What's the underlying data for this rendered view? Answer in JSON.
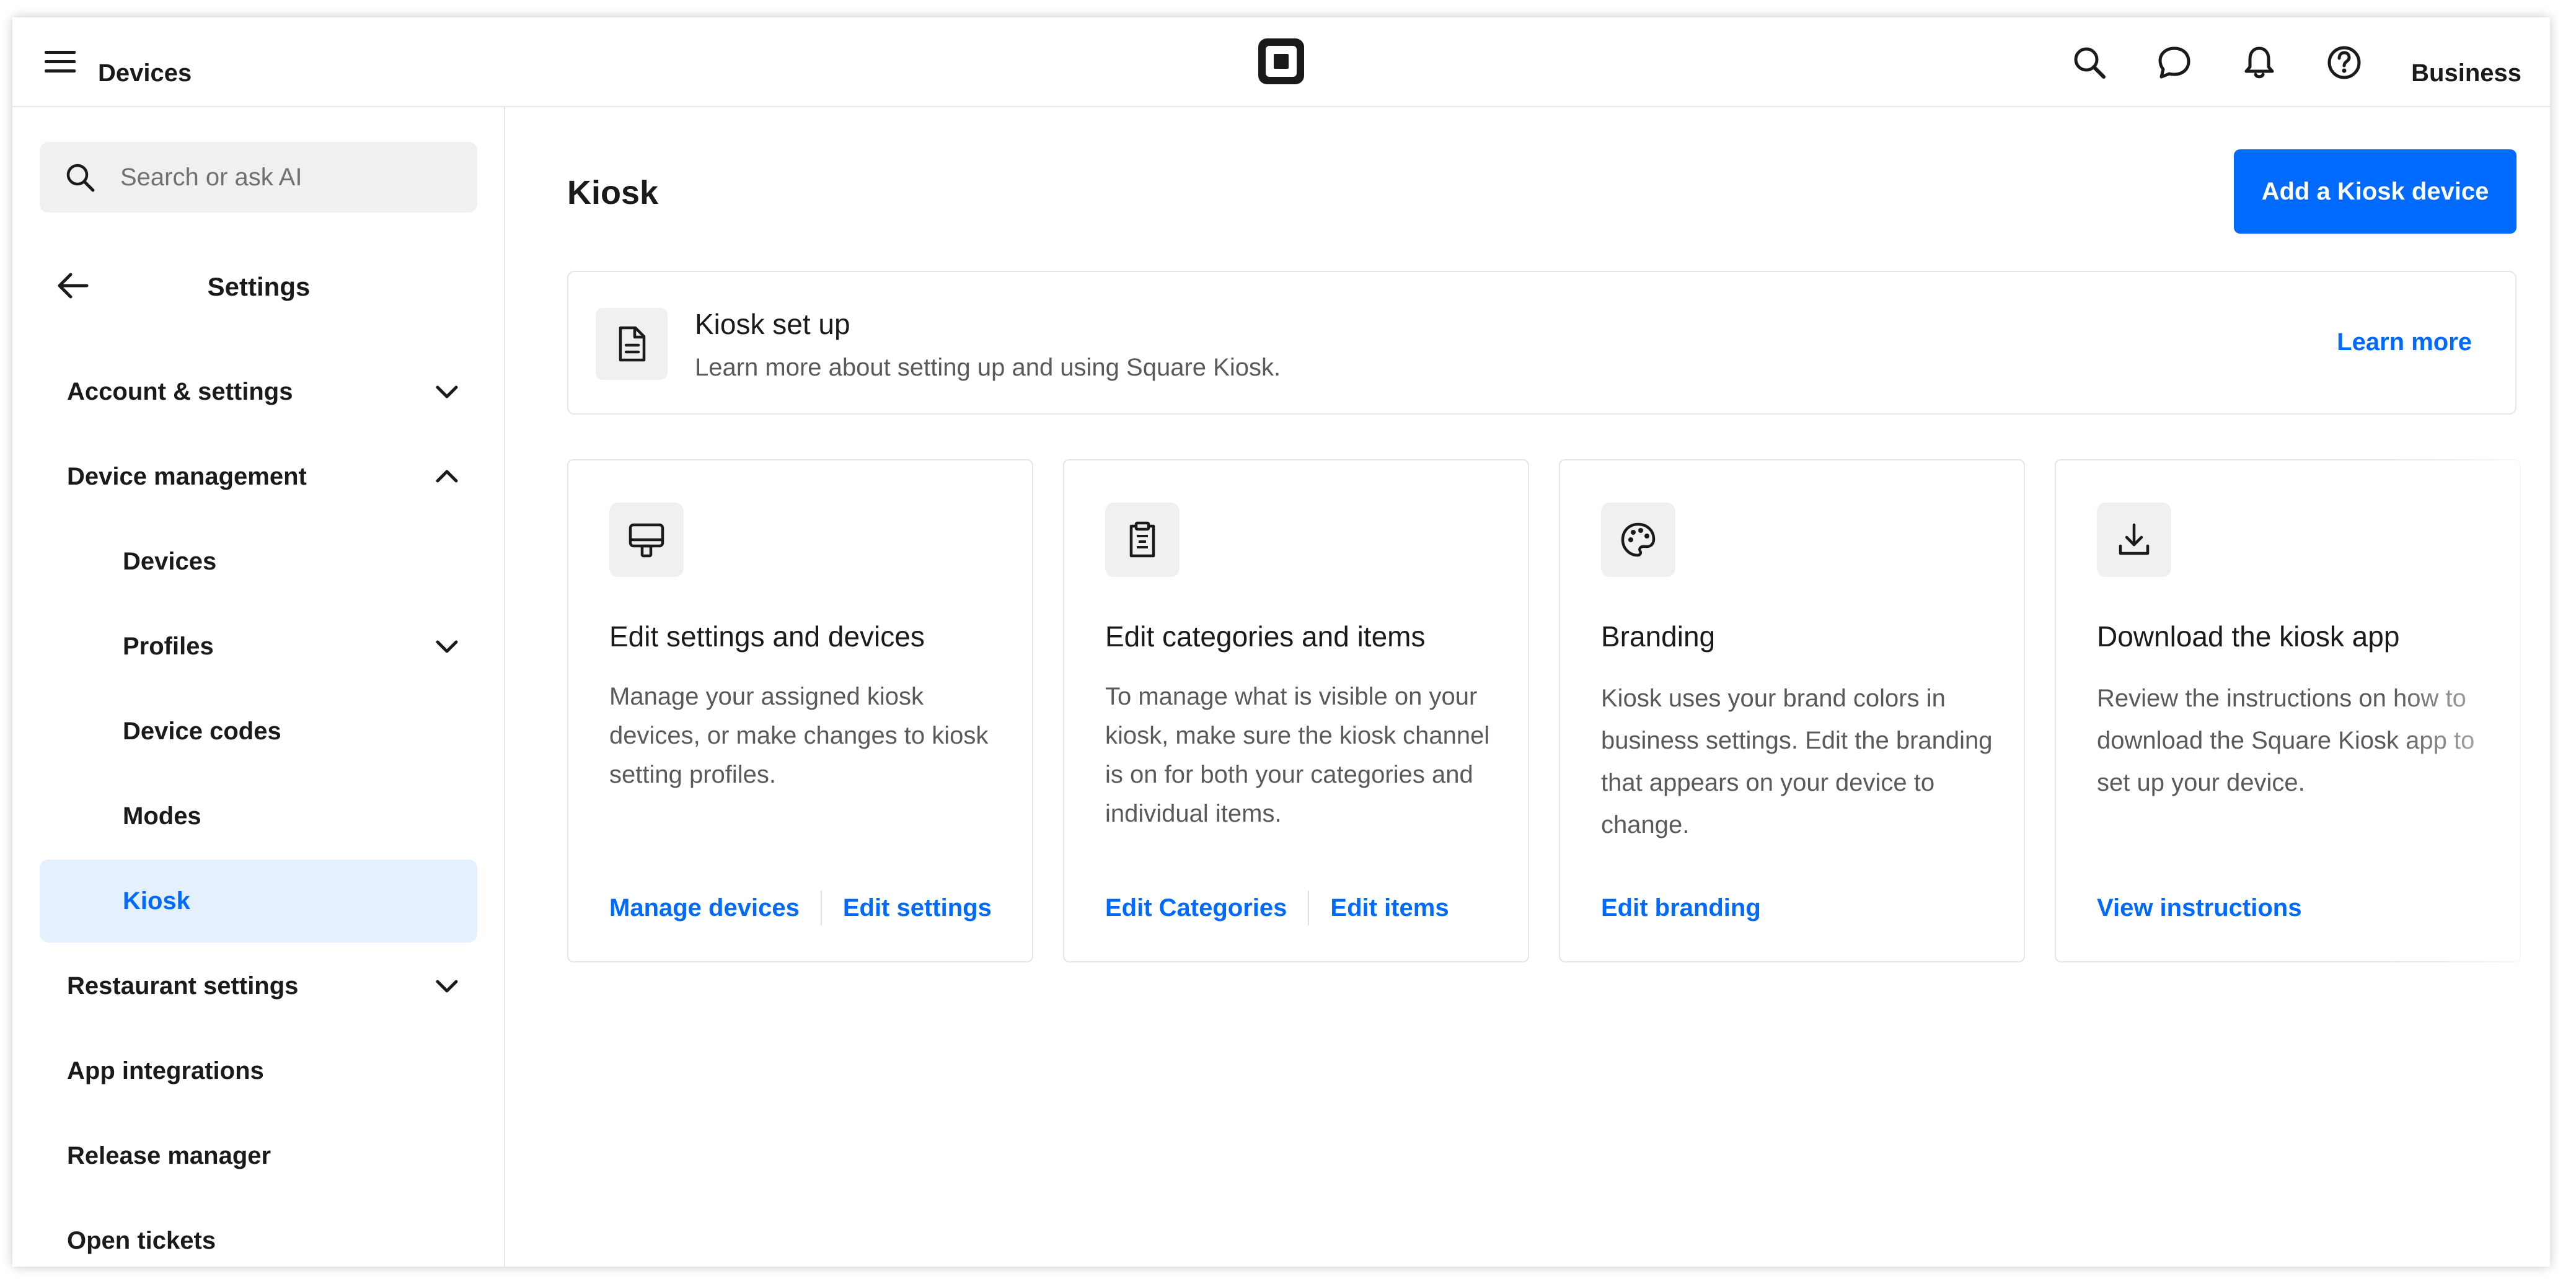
{
  "topbar": {
    "title": "Devices",
    "account": "Business",
    "icons": [
      "menu-icon",
      "square-logo-icon",
      "search-icon",
      "chat-icon",
      "bell-icon",
      "help-icon"
    ]
  },
  "sidebar": {
    "search_placeholder": "Search or ask AI",
    "heading": "Settings",
    "items": [
      {
        "label": "Account & settings",
        "chevron": "down"
      },
      {
        "label": "Device management",
        "chevron": "up"
      },
      {
        "label": "Devices"
      },
      {
        "label": "Profiles",
        "chevron": "down"
      },
      {
        "label": "Device codes"
      },
      {
        "label": "Modes"
      },
      {
        "label": "Kiosk",
        "active": true
      },
      {
        "label": "Restaurant settings",
        "chevron": "down"
      },
      {
        "label": "App integrations"
      },
      {
        "label": "Release manager"
      },
      {
        "label": "Open tickets"
      }
    ]
  },
  "main": {
    "title": "Kiosk",
    "primary_button": "Add a Kiosk device",
    "banner": {
      "title": "Kiosk set up",
      "description": "Learn more about setting up and using Square Kiosk.",
      "link": "Learn more"
    },
    "cards": [
      {
        "icon": "monitor-icon",
        "title": "Edit settings and devices",
        "description": "Manage your assigned kiosk devices, or make changes to kiosk setting profiles.",
        "links": [
          "Manage devices",
          "Edit settings"
        ]
      },
      {
        "icon": "clipboard-list-icon",
        "title": "Edit categories and items",
        "description": "To manage what is visible on your kiosk, make sure the kiosk channel is on for both your categories and individual items.",
        "links": [
          "Edit Categories",
          "Edit items"
        ]
      },
      {
        "icon": "palette-icon",
        "title": "Branding",
        "description": "Kiosk uses your brand colors in business settings. Edit the branding that appears on your device to change.",
        "links": [
          "Edit branding"
        ]
      },
      {
        "icon": "download-icon",
        "title": "Download the kiosk app",
        "description": "Review the instructions on how to download the Square Kiosk app to set up your device.",
        "links": [
          "View instructions"
        ]
      }
    ]
  },
  "colors": {
    "accent": "#006aff",
    "active_bg": "#e5f0ff",
    "muted_text": "#5a5a5a",
    "border": "#e6e6e6"
  }
}
